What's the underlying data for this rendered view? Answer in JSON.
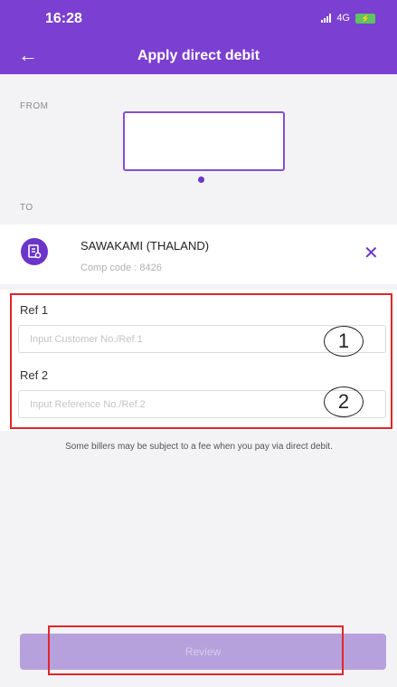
{
  "status_bar": {
    "time": "16:28",
    "network": "4G"
  },
  "header": {
    "title": "Apply direct debit"
  },
  "from_section": {
    "label": "FROM"
  },
  "to_section": {
    "label": "TO",
    "biller_name": "SAWAKAMI (THALAND)",
    "comp_code": "Comp code : 8426"
  },
  "ref1": {
    "label": "Ref 1",
    "placeholder": "Input Customer No./Ref.1"
  },
  "ref2": {
    "label": "Ref 2",
    "placeholder": "Input Reference No./Ref.2"
  },
  "fee_note": "Some billers may be subject to a fee when you pay via direct debit.",
  "review_button": {
    "label": "Review"
  },
  "annotations": {
    "marker_1": "1",
    "marker_2": "2"
  },
  "icons": [
    "back-arrow-icon",
    "signal-icon",
    "battery-icon",
    "biller-icon",
    "close-icon"
  ],
  "colors": {
    "accent": "#7b3fd1",
    "annotation": "#e0262b",
    "button_disabled": "#b7a1dc"
  }
}
